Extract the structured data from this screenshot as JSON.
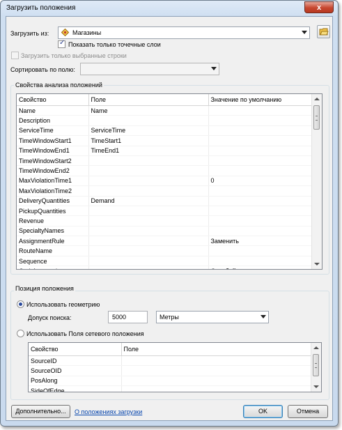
{
  "window": {
    "title": "Загрузить положения",
    "close_glyph": "x"
  },
  "load_from": {
    "label": "Загрузить из:",
    "value": "Магазины",
    "show_point_layers_label": "Показать только точечные слои",
    "show_point_layers_checked": true,
    "load_selected_label": "Загрузить только выбранные строки",
    "load_selected_checked": false,
    "sort_by_label": "Сортировать по полю:",
    "sort_by_value": ""
  },
  "properties_group": {
    "title": "Свойства анализа положений",
    "columns": [
      "Свойство",
      "Поле",
      "Значение по умолчанию"
    ],
    "rows": [
      [
        "Name",
        "Name",
        ""
      ],
      [
        "Description",
        "",
        ""
      ],
      [
        "ServiceTime",
        "ServiceTime",
        ""
      ],
      [
        "TimeWindowStart1",
        "TimeStart1",
        ""
      ],
      [
        "TimeWindowEnd1",
        "TimeEnd1",
        ""
      ],
      [
        "TimeWindowStart2",
        "",
        ""
      ],
      [
        "TimeWindowEnd2",
        "",
        ""
      ],
      [
        "MaxViolationTime1",
        "",
        "0"
      ],
      [
        "MaxViolationTime2",
        "",
        ""
      ],
      [
        "DeliveryQuantities",
        "Demand",
        ""
      ],
      [
        "PickupQuantities",
        "",
        ""
      ],
      [
        "Revenue",
        "",
        ""
      ],
      [
        "SpecialtyNames",
        "",
        ""
      ],
      [
        "AssignmentRule",
        "",
        "Заменить"
      ],
      [
        "RouteName",
        "",
        ""
      ],
      [
        "Sequence",
        "",
        ""
      ],
      [
        "CurbApproach",
        "",
        "С любой стороны"
      ]
    ]
  },
  "position_group": {
    "title": "Позиция положения",
    "use_geometry_label": "Использовать геометрию",
    "use_geometry_selected": true,
    "tolerance_label": "Допуск поиска:",
    "tolerance_value": "5000",
    "units_value": "Метры",
    "use_network_fields_label": "Использовать Поля сетевого положения",
    "use_network_fields_selected": false,
    "network_columns": [
      "Свойство",
      "Поле"
    ],
    "network_rows": [
      [
        "SourceID",
        ""
      ],
      [
        "SourceOID",
        ""
      ],
      [
        "PosAlong",
        ""
      ],
      [
        "SideOfEdge",
        ""
      ]
    ]
  },
  "footer": {
    "advanced_label": "Дополнительно...",
    "about_link": "О положениях загрузки",
    "ok_label": "OK",
    "cancel_label": "Отмена"
  },
  "colors": {
    "title_bg": "#cfdff1",
    "close_button": "#c7462f",
    "link": "#0645ad"
  },
  "icons": [
    "layer-icon",
    "open-folder-icon",
    "close-icon",
    "chevron-down-icon"
  ]
}
